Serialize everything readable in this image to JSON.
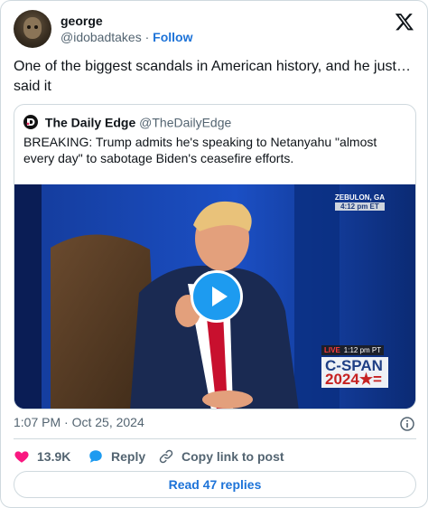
{
  "author": {
    "name": "george",
    "handle": "@idobadtakes",
    "separator": "·",
    "follow_label": "Follow"
  },
  "tweet": {
    "text": "One of the biggest scandals in American history, and he just… said it",
    "time": "1:07 PM",
    "date": "Oct 25, 2024",
    "separator": "·"
  },
  "quoted": {
    "name": "The Daily Edge",
    "handle": "@TheDailyEdge",
    "text": "BREAKING: Trump admits he's speaking to Netanyahu \"almost every day\" to sabotage Biden's ceasefire efforts.",
    "video_overlay": {
      "location": "ZEBULON, GA",
      "location_time": "4:12 pm ET",
      "live_label": "LIVE",
      "live_time": "1:12 pm PT",
      "network": "C-SPAN",
      "network_year": "2024★="
    }
  },
  "actions": {
    "like_count": "13.9K",
    "reply_label": "Reply",
    "copy_label": "Copy link to post"
  },
  "read_replies_label": "Read 47 replies",
  "colors": {
    "accent": "#1d9bf0",
    "like": "#f91880",
    "link": "#1d73d8",
    "border": "#cfd9de"
  },
  "icons": [
    "x-logo-icon",
    "play-icon",
    "info-icon",
    "heart-icon",
    "reply-bubble-icon",
    "link-icon"
  ]
}
